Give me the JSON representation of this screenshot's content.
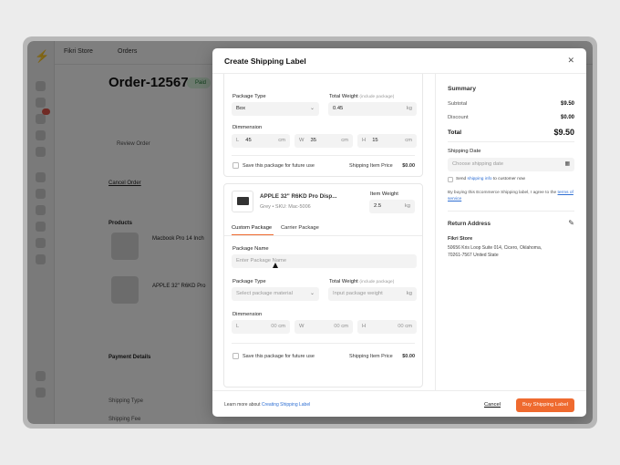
{
  "background": {
    "store_name": "Fikri Store",
    "nav_orders": "Orders",
    "order_title": "Order-12567",
    "paid_badge": "Paid",
    "cancel_order": "Cancel Order",
    "products_heading": "Products",
    "product1_name": "Macbook Pro 14 Inch",
    "product2_name": "APPLE 32\" R6KD Pro",
    "payment_details": "Payment Details",
    "review_order": "Review Order",
    "shipping_type": "Shipping Type",
    "shipping_fee": "Shipping Fee"
  },
  "modal": {
    "title": "Create Shipping Label",
    "package1": {
      "package_type_label": "Package Type",
      "package_type_value": "Box",
      "total_weight_label": "Total Weight",
      "total_weight_hint": "(include package)",
      "total_weight_value": "0.45",
      "weight_unit": "kg",
      "dimension_label": "Dimmension",
      "l_prefix": "L",
      "l_value": "45",
      "w_prefix": "W",
      "w_value": "35",
      "h_prefix": "H",
      "h_value": "15",
      "dim_unit": "cm",
      "save_label": "Save this package for future use",
      "price_label": "Shipping Item Price",
      "price_value": "$0.00"
    },
    "product": {
      "name": "APPLE 32\" R6KD Pro Disp...",
      "variant": "Grey",
      "sku": "SKU: Mac-5006",
      "item_weight_label": "Item Weight",
      "item_weight_value": "2.5",
      "weight_unit": "kg"
    },
    "tabs": [
      "Custom Package",
      "Carrier Package"
    ],
    "package2": {
      "package_name_label": "Package Name",
      "package_name_placeholder": "Enter Package Name",
      "package_type_label": "Package Type",
      "package_type_placeholder": "Select package material",
      "total_weight_label": "Total Weight",
      "total_weight_hint": "(include package)",
      "total_weight_placeholder": "Input package weight",
      "weight_unit": "kg",
      "dimension_label": "Dimmension",
      "l_prefix": "L",
      "w_prefix": "W",
      "h_prefix": "H",
      "dim_placeholder": "00",
      "dim_unit": "cm",
      "save_label": "Save this package for future use",
      "price_label": "Shipping Item Price",
      "price_value": "$0.00"
    },
    "summary": {
      "heading": "Summary",
      "subtotal_label": "Subtotal",
      "subtotal_value": "$9.50",
      "discount_label": "Discount",
      "discount_value": "$0.00",
      "total_label": "Total",
      "total_value": "$9.50",
      "shipping_date_label": "Shipping Date",
      "shipping_date_placeholder": "Choose shipping date",
      "send_label_pre": "Send ",
      "send_label_link": "shipping info",
      "send_label_post": " to customer now",
      "terms_pre": "By buying this Ecommerce Shipping label, I agree to the ",
      "terms_link": "terms of service"
    },
    "return_address": {
      "heading": "Return Address",
      "name": "Fikri Store",
      "line1": "50656 Kris Loop Suite 014, Cicero, Oklahoma,",
      "line2": "70261-7567 United State"
    },
    "footer": {
      "learn_pre": "Learn more about ",
      "learn_link": "Creating Shipping Label",
      "cancel": "Cancel",
      "buy": "Buy Shipping Label"
    }
  },
  "colors": {
    "accent": "#ef6a2f",
    "link": "#2f6fd3",
    "paid": "#1d7a34"
  }
}
